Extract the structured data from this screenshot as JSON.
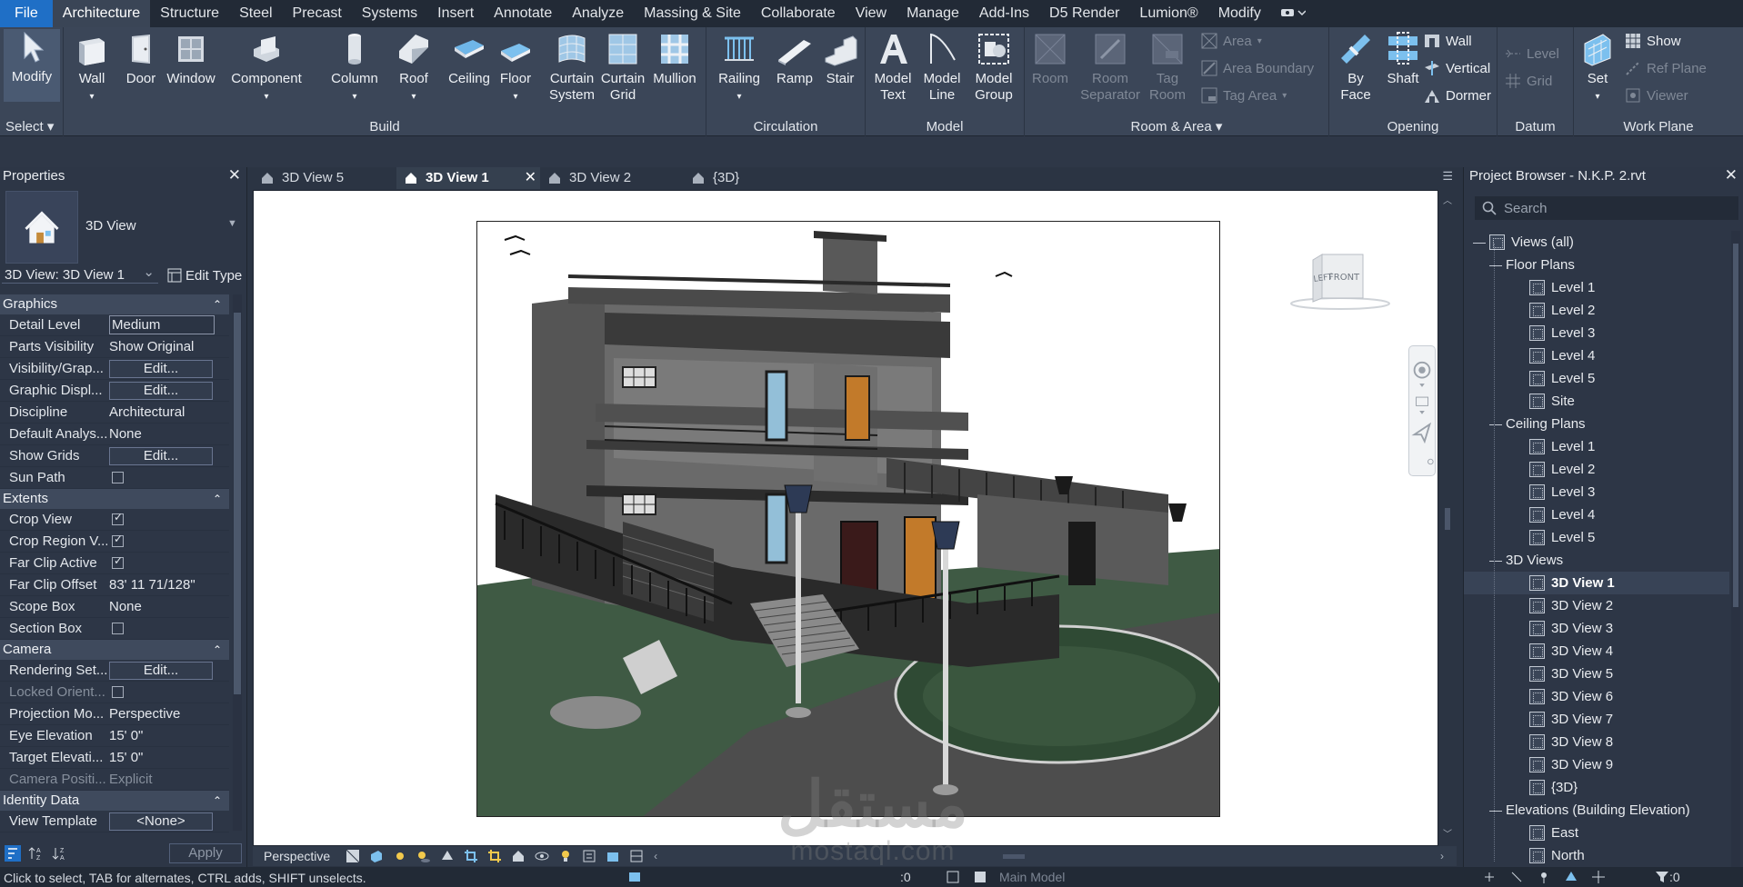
{
  "menu": {
    "file": "File",
    "items": [
      "Architecture",
      "Structure",
      "Steel",
      "Precast",
      "Systems",
      "Insert",
      "Annotate",
      "Analyze",
      "Massing & Site",
      "Collaborate",
      "View",
      "Manage",
      "Add-Ins",
      "D5 Render",
      "Lumion®",
      "Modify"
    ],
    "active": "Architecture"
  },
  "ribbon": {
    "select": {
      "modify": "Modify",
      "title": "Select"
    },
    "build": {
      "title": "Build",
      "wall": "Wall",
      "door": "Door",
      "window": "Window",
      "component": "Component",
      "column": "Column",
      "roof": "Roof",
      "ceiling": "Ceiling",
      "floor": "Floor",
      "curtain_system": [
        "Curtain",
        "System"
      ],
      "curtain_grid": [
        "Curtain",
        "Grid"
      ],
      "mullion": "Mullion"
    },
    "circulation": {
      "title": "Circulation",
      "railing": "Railing",
      "ramp": "Ramp",
      "stair": "Stair"
    },
    "model": {
      "title": "Model",
      "model_text": [
        "Model",
        "Text"
      ],
      "model_line": [
        "Model",
        "Line"
      ],
      "model_group": [
        "Model",
        "Group"
      ]
    },
    "room_area": {
      "title": "Room & Area",
      "room": "Room",
      "room_separator": [
        "Room",
        "Separator"
      ],
      "tag_room": [
        "Tag",
        "Room"
      ],
      "area": "Area",
      "area_boundary": "Area  Boundary",
      "tag_area": "Tag  Area"
    },
    "opening": {
      "title": "Opening",
      "by_face": [
        "By",
        "Face"
      ],
      "shaft": "Shaft",
      "wall": "Wall",
      "vertical": "Vertical",
      "dormer": "Dormer"
    },
    "datum": {
      "title": "Datum",
      "level": "Level",
      "grid": "Grid"
    },
    "work_plane": {
      "title": "Work Plane",
      "set": "Set",
      "show": "Show",
      "ref_plane": "Ref  Plane",
      "viewer": "Viewer"
    }
  },
  "properties": {
    "title": "Properties",
    "type_name": "3D View",
    "instance": "3D View: 3D View 1",
    "edit_type": "Edit Type",
    "groups": [
      {
        "name": "Graphics",
        "rows": [
          {
            "k": "Detail Level",
            "v": "Medium",
            "kind": "box"
          },
          {
            "k": "Parts Visibility",
            "v": "Show Original",
            "kind": "text"
          },
          {
            "k": "Visibility/Grap...",
            "v": "Edit...",
            "kind": "btn"
          },
          {
            "k": "Graphic Displ...",
            "v": "Edit...",
            "kind": "btn"
          },
          {
            "k": "Discipline",
            "v": "Architectural",
            "kind": "text"
          },
          {
            "k": "Default Analys...",
            "v": "None",
            "kind": "text"
          },
          {
            "k": "Show Grids",
            "v": "Edit...",
            "kind": "btn"
          },
          {
            "k": "Sun Path",
            "v": "",
            "kind": "cb",
            "checked": false
          }
        ]
      },
      {
        "name": "Extents",
        "rows": [
          {
            "k": "Crop View",
            "v": "",
            "kind": "cb",
            "checked": true
          },
          {
            "k": "Crop Region V...",
            "v": "",
            "kind": "cb",
            "checked": true
          },
          {
            "k": "Far Clip Active",
            "v": "",
            "kind": "cb",
            "checked": true
          },
          {
            "k": "Far Clip Offset",
            "v": "83'  11 71/128\"",
            "kind": "text"
          },
          {
            "k": "Scope Box",
            "v": "None",
            "kind": "text"
          },
          {
            "k": "Section Box",
            "v": "",
            "kind": "cb",
            "checked": false
          }
        ]
      },
      {
        "name": "Camera",
        "rows": [
          {
            "k": "Rendering Set...",
            "v": "Edit...",
            "kind": "btn"
          },
          {
            "k": "Locked Orient...",
            "v": "",
            "kind": "cb",
            "checked": false,
            "disabled": true
          },
          {
            "k": "Projection Mo...",
            "v": "Perspective",
            "kind": "text"
          },
          {
            "k": "Eye Elevation",
            "v": "15'  0\"",
            "kind": "text"
          },
          {
            "k": "Target Elevati...",
            "v": "15'  0\"",
            "kind": "text"
          },
          {
            "k": "Camera Positi...",
            "v": "Explicit",
            "kind": "text",
            "disabled": true
          }
        ]
      },
      {
        "name": "Identity Data",
        "rows": [
          {
            "k": "View Template",
            "v": "<None>",
            "kind": "btn"
          }
        ]
      }
    ],
    "apply": "Apply"
  },
  "tabs": [
    {
      "label": "3D View 5",
      "active": false
    },
    {
      "label": "3D View 1",
      "active": true
    },
    {
      "label": "3D View 2",
      "active": false
    },
    {
      "label": "{3D}",
      "active": false
    }
  ],
  "viewcube": {
    "left": "LEFT",
    "front": "FRONT"
  },
  "view_control": {
    "mode": "Perspective"
  },
  "browser": {
    "title": "Project Browser - N.K.P. 2.rvt",
    "search_placeholder": "Search",
    "root": "Views (all)",
    "floor_plans": {
      "label": "Floor Plans",
      "items": [
        "Level 1",
        "Level 2",
        "Level 3",
        "Level 4",
        "Level 5",
        "Site"
      ]
    },
    "ceiling_plans": {
      "label": "Ceiling Plans",
      "items": [
        "Level 1",
        "Level 2",
        "Level 3",
        "Level 4",
        "Level 5"
      ]
    },
    "views_3d": {
      "label": "3D Views",
      "items": [
        "3D View 1",
        "3D View 2",
        "3D View 3",
        "3D View 4",
        "3D View 5",
        "3D View 6",
        "3D View 7",
        "3D View 8",
        "3D View 9",
        "{3D}"
      ],
      "selected": "3D View 1"
    },
    "elevations": {
      "label": "Elevations (Building Elevation)",
      "items": [
        "East",
        "North"
      ]
    }
  },
  "status": {
    "message": "Click to select, TAB for alternates, CTRL adds, SHIFT unselects.",
    "workset": "Main Model",
    "filter_count": ":0",
    "coord": ":0"
  },
  "watermark": {
    "arabic": "مستقل",
    "latin": "mostaql.com"
  },
  "colors": {
    "accent": "#1f6fc6",
    "ribbon": "#3b4658",
    "panel": "#2d3646"
  }
}
